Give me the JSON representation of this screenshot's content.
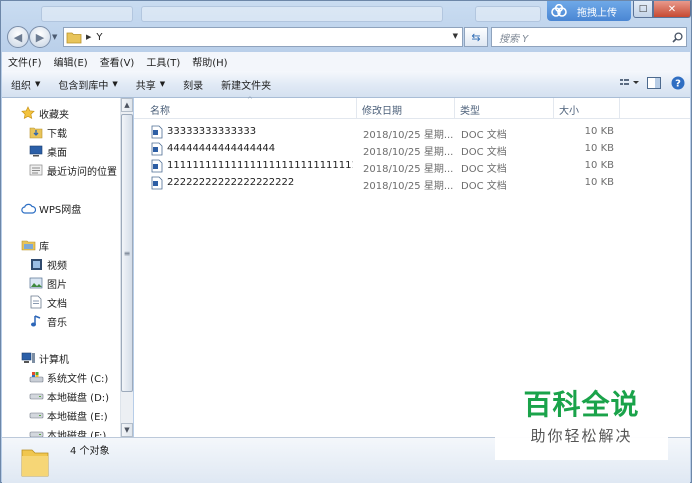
{
  "titlebar": {
    "cloud_button_label": "拖拽上传",
    "restore_glyph": "□",
    "close_glyph": "✕"
  },
  "address": {
    "path": "Y",
    "search_placeholder": "搜索 Y"
  },
  "menu": {
    "items": [
      "文件(F)",
      "编辑(E)",
      "查看(V)",
      "工具(T)",
      "帮助(H)"
    ]
  },
  "toolbar": {
    "organize": "组织",
    "include_in_library": "包含到库中",
    "share": "共享",
    "burn": "刻录",
    "new_folder": "新建文件夹"
  },
  "nav": {
    "favorites": "收藏夹",
    "downloads": "下载",
    "desktop": "桌面",
    "recent": "最近访问的位置",
    "wps": "WPS网盘",
    "libraries": "库",
    "videos": "视频",
    "pictures": "图片",
    "documents": "文档",
    "music": "音乐",
    "computer": "计算机",
    "drive_c": "系统文件 (C:)",
    "drive_d": "本地磁盘 (D:)",
    "drive_e": "本地磁盘 (E:)",
    "drive_f": "本地磁盘 (F:)"
  },
  "columns": {
    "name": "名称",
    "date": "修改日期",
    "type": "类型",
    "size": "大小"
  },
  "files": [
    {
      "name": "33333333333333",
      "date": "2018/10/25 星期...",
      "type": "DOC 文档",
      "size": "10 KB"
    },
    {
      "name": "44444444444444444",
      "date": "2018/10/25 星期...",
      "type": "DOC 文档",
      "size": "10 KB"
    },
    {
      "name": "1111111111111111111111111111111111...",
      "date": "2018/10/25 星期...",
      "type": "DOC 文档",
      "size": "10 KB"
    },
    {
      "name": "22222222222222222222",
      "date": "2018/10/25 星期...",
      "type": "DOC 文档",
      "size": "10 KB"
    }
  ],
  "status": {
    "item_count": "4 个对象"
  },
  "watermark": {
    "title": "百科全说",
    "subtitle": "助你轻松解决"
  },
  "colors": {
    "watermark_green": "#1aa34a",
    "cloud_blue": "#4a86d3",
    "close_red": "#c74a32"
  }
}
